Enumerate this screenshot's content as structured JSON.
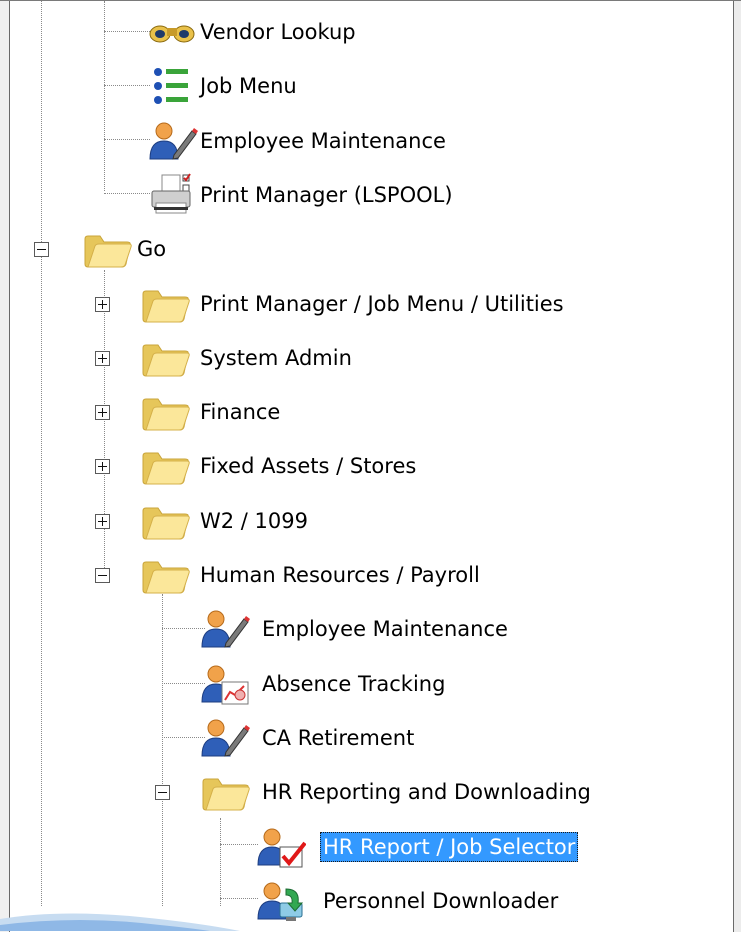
{
  "tree": {
    "items": [
      {
        "label": "Vendor Lookup",
        "icon": "binoculars-icon"
      },
      {
        "label": "Job Menu",
        "icon": "list-icon"
      },
      {
        "label": "Employee Maintenance",
        "icon": "user-edit-icon"
      },
      {
        "label": "Print Manager (LSPOOL)",
        "icon": "printer-icon"
      },
      {
        "label": "Go",
        "icon": "folder-icon",
        "expanded": true
      },
      {
        "label": "Print Manager / Job Menu / Utilities",
        "icon": "folder-icon",
        "expanded": false
      },
      {
        "label": "System Admin",
        "icon": "folder-icon",
        "expanded": false
      },
      {
        "label": "Finance",
        "icon": "folder-icon",
        "expanded": false
      },
      {
        "label": "Fixed Assets / Stores",
        "icon": "folder-icon",
        "expanded": false
      },
      {
        "label": "W2 / 1099",
        "icon": "folder-icon",
        "expanded": false
      },
      {
        "label": "Human Resources / Payroll",
        "icon": "folder-icon",
        "expanded": true
      },
      {
        "label": "Employee Maintenance",
        "icon": "user-edit-icon"
      },
      {
        "label": "Absence Tracking",
        "icon": "user-chart-icon"
      },
      {
        "label": "CA Retirement",
        "icon": "user-edit-icon"
      },
      {
        "label": "HR Reporting and Downloading",
        "icon": "folder-icon",
        "expanded": true
      },
      {
        "label": "HR Report / Job Selector",
        "icon": "user-check-icon",
        "selected": true
      },
      {
        "label": "Personnel Downloader",
        "icon": "user-download-icon"
      }
    ]
  },
  "colors": {
    "selection": "#3399ff",
    "folder": "#f7df7c",
    "tree_lines": "#8a8a8a"
  }
}
